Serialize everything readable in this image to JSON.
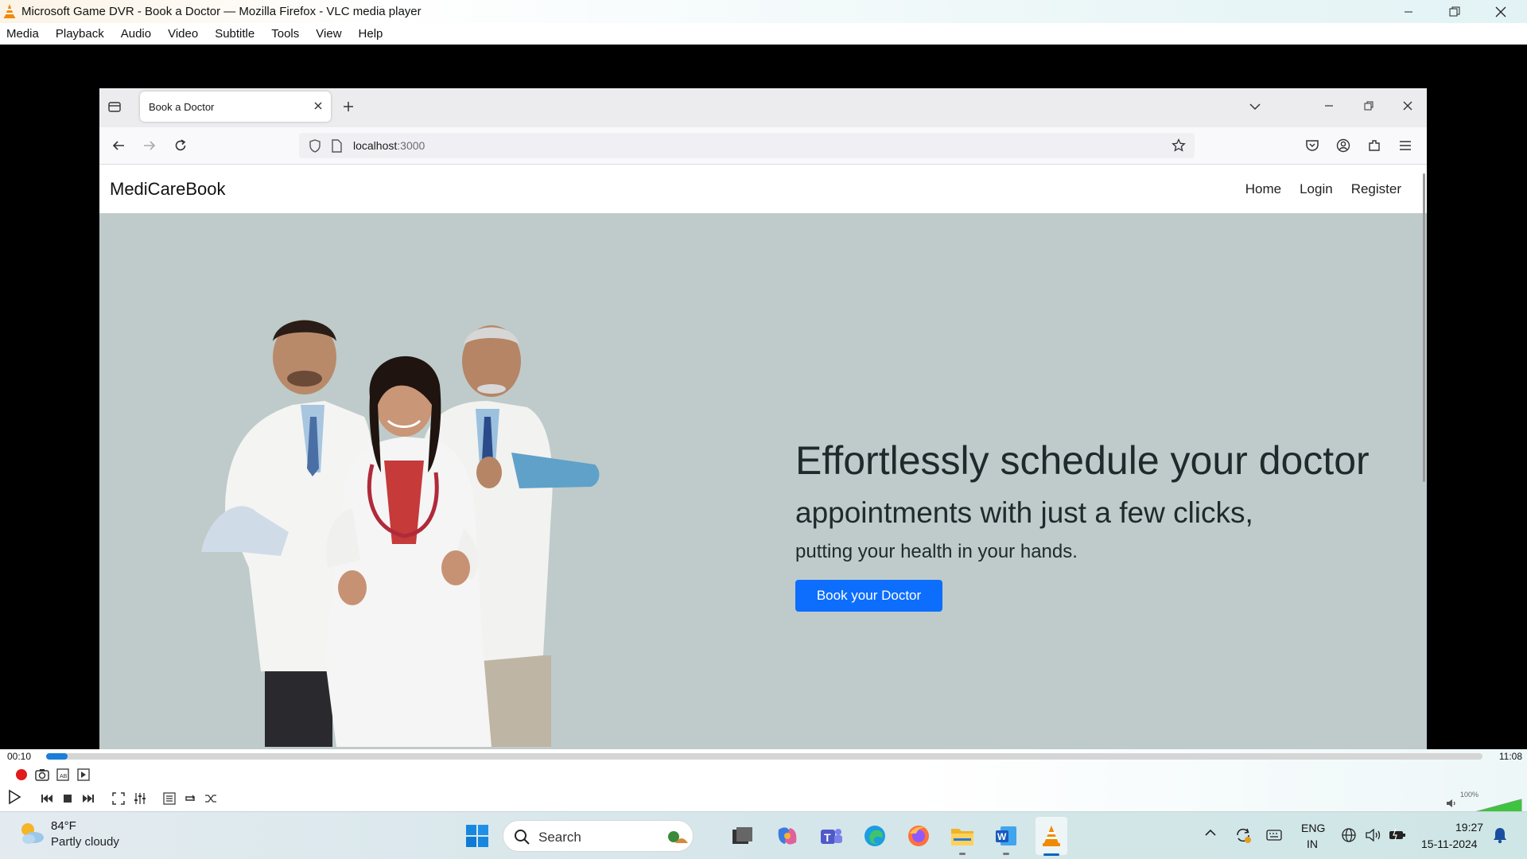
{
  "vlc": {
    "title": "Microsoft Game DVR - Book a Doctor — Mozilla Firefox - VLC media player",
    "menu": [
      "Media",
      "Playback",
      "Audio",
      "Video",
      "Subtitle",
      "Tools",
      "View",
      "Help"
    ],
    "time_elapsed": "00:10",
    "time_total": "11:08",
    "playback_progress": 0.015,
    "volume_label": "100%",
    "volume_level": 1.0,
    "accent_color": "#1b7ed8",
    "record_color": "#e01b1b"
  },
  "firefox": {
    "tab_title": "Book a Doctor",
    "url_host": "localhost",
    "url_port": ":3000"
  },
  "site": {
    "brand": "MediCareBook",
    "nav_links": [
      "Home",
      "Login",
      "Register"
    ],
    "hero": {
      "headline": "Effortlessly schedule your doctor",
      "subheadline": "appointments with just a few clicks,",
      "tagline": "putting your health in your hands.",
      "cta_label": "Book your Doctor",
      "cta_color": "#0d6efd",
      "background_color": "#becbca",
      "image_icon": "doctors-group-photo"
    }
  },
  "taskbar": {
    "weather_temp": "84°F",
    "weather_condition": "Partly cloudy",
    "search_label": "Search",
    "language_line1": "ENG",
    "language_line2": "IN",
    "clock_time": "19:27",
    "clock_date": "15-11-2024",
    "apps": [
      "file-manager-icon",
      "copilot-icon",
      "teams-icon",
      "edge-icon",
      "firefox-icon",
      "file-explorer-icon",
      "word-icon",
      "vlc-icon"
    ]
  }
}
